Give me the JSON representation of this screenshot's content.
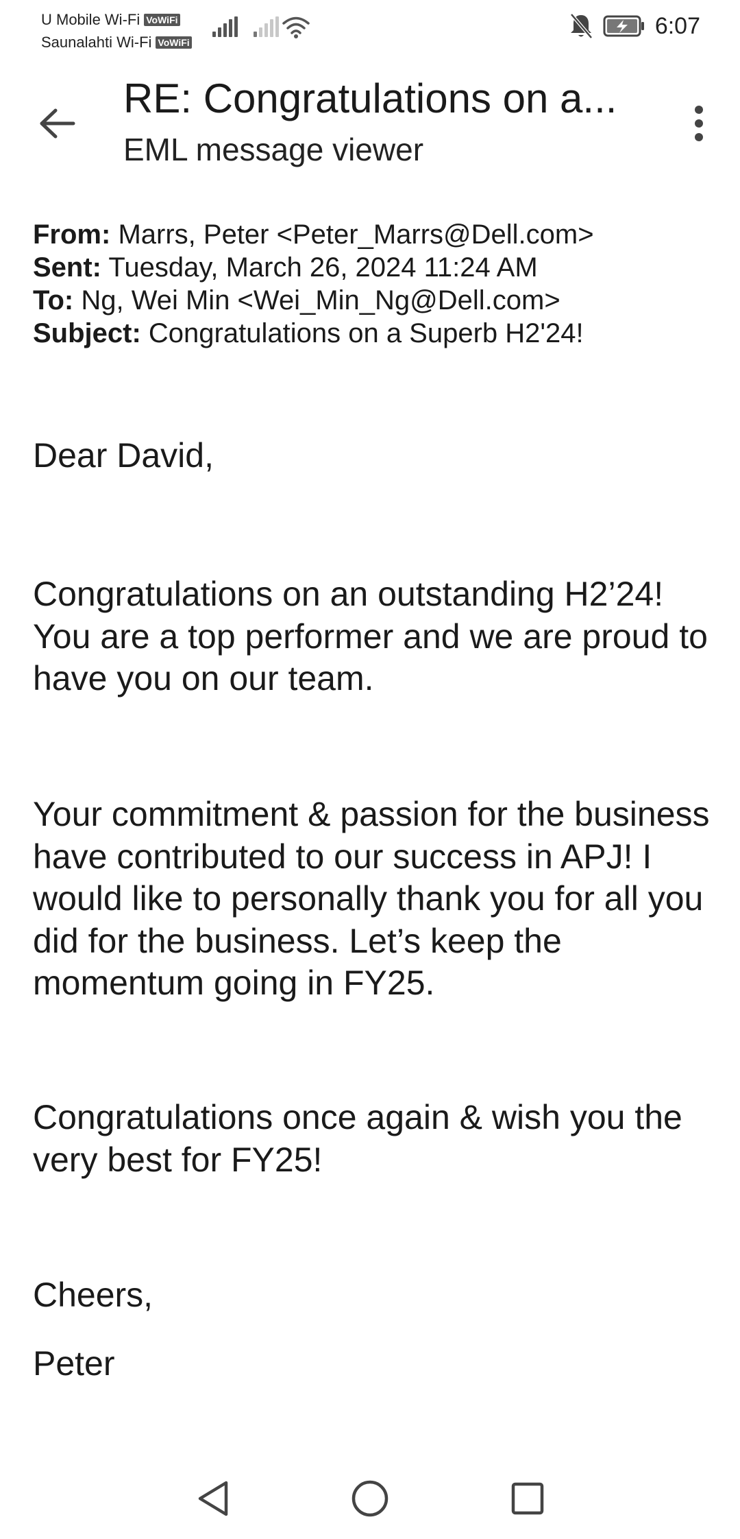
{
  "status_bar": {
    "carrier_1": "U Mobile Wi-Fi",
    "carrier_2": "Saunalahti Wi-Fi",
    "vowifi_badge": "VoWiFi",
    "time": "6:07",
    "icons": [
      "signal-icon",
      "wifi-icon",
      "bell-off-icon",
      "battery-charging-icon"
    ]
  },
  "app_bar": {
    "title": "RE: Congratulations on a...",
    "subtitle": "EML message viewer",
    "icons": [
      "back-arrow-icon",
      "more-vert-icon"
    ]
  },
  "email": {
    "headers": {
      "from_label": "From:",
      "from_value": "Marrs, Peter <Peter_Marrs@Dell.com>",
      "sent_label": "Sent:",
      "sent_value": "Tuesday, March 26, 2024 11:24 AM",
      "to_label": "To:",
      "to_value": "Ng, Wei Min <Wei_Min_Ng@Dell.com>",
      "subject_label": "Subject:",
      "subject_value": "Congratulations on a Superb H2'24!"
    },
    "body": {
      "greeting": "Dear David,",
      "paragraph_1": "Congratulations on an outstanding H2’24! You are a top performer and we are proud to have you on our team.",
      "paragraph_2": "Your commitment & passion for the business have contributed to our success in APJ! I would like to personally thank you for all you did for the business. Let’s keep the momentum going in FY25.",
      "paragraph_3": "Congratulations once again & wish you the very best for FY25!",
      "closing": "Cheers,",
      "signature": "Peter"
    }
  },
  "nav_bar": {
    "icons": [
      "nav-back-icon",
      "nav-home-icon",
      "nav-recents-icon"
    ]
  }
}
